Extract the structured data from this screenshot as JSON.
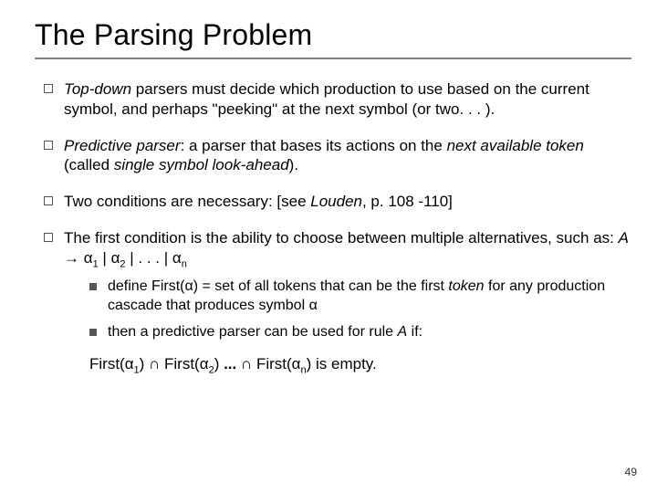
{
  "title": "The Parsing Problem",
  "bullets": {
    "b1": {
      "lead": "Top-down",
      "rest": " parsers must decide which production to use based on the current symbol, and perhaps \"peeking\" at the next symbol (or two. . . )."
    },
    "b2": {
      "lead1": "Predictive parser",
      "mid1": ":  a parser that bases its actions on the ",
      "lead2": "next available token",
      "mid2": " (called ",
      "lead3": "single symbol look-ahead",
      "tail": ")."
    },
    "b3": {
      "pre": "Two conditions are necessary:  [see ",
      "src": "Louden",
      "post": ", p. 108 -110]"
    },
    "b4": {
      "line1": "The first condition is the ability to choose between multiple alternatives, such as:   ",
      "rule_lhs": "A",
      "arrow": " → ",
      "a": "α",
      "sub1": "1",
      "bar": " | ",
      "sub2": "2",
      "dots": " | . . . | ",
      "subn": "n"
    },
    "s1": {
      "pre": "define First(",
      "a": "α",
      "mid": ") = set of all tokens that can be the first ",
      "token": "token",
      "post": " for any production cascade that produces symbol ",
      "a2": "α"
    },
    "s2": {
      "pre": " then a predictive parser can be used for rule ",
      "A": "A",
      "post": " if:"
    },
    "final": {
      "F": "First(",
      "a": "α",
      "s1": "1",
      "close": ") ",
      "cap": "∩",
      "sp": " ",
      "s2": "2",
      "dots": " ...  ",
      "sn": "n",
      "tail": ") is empty."
    }
  },
  "page_number": "49"
}
